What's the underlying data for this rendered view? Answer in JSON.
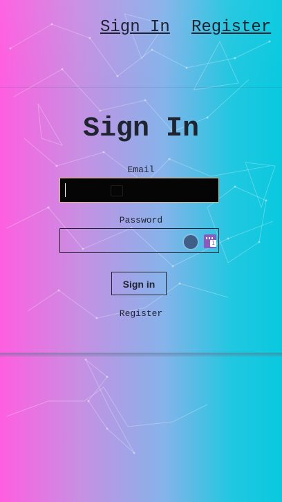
{
  "nav": {
    "sign_in": "Sign In",
    "register": "Register"
  },
  "form": {
    "title": "Sign In",
    "email_label": "Email",
    "email_value": "",
    "password_label": "Password",
    "password_value": "",
    "submit_label": "Sign in",
    "register_link": "Register"
  },
  "theme": {
    "gradient_left": "#ff5ee0",
    "gradient_right": "#09c9df",
    "text": "#1f2430",
    "email_bg": "#050505",
    "email_border": "#e0b889"
  },
  "icons": {
    "password_toggle": "eye-toggle-icon",
    "password_manager": "password-manager-icon"
  }
}
